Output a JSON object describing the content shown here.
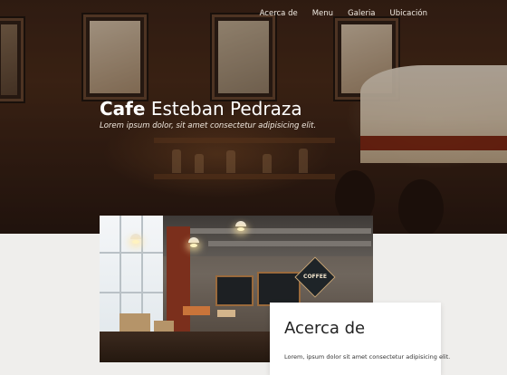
{
  "nav": {
    "items": [
      "Acerca de",
      "Menu",
      "Galeria",
      "Ubicación"
    ]
  },
  "hero": {
    "title_bold": "Cafe",
    "title_light": "Esteban Pedraza",
    "subtitle": "Lorem ipsum dolor, sit amet consectetur adipisicing elit."
  },
  "photo": {
    "sign_text": "COFFEE"
  },
  "about": {
    "title": "Acerca de",
    "text": "Lorem, ipsum dolor sit amet consectetur adipisicing elit."
  },
  "colors": {
    "hero_dark": "#3a2418",
    "page_bg": "#efeeec",
    "card_bg": "#ffffff"
  }
}
